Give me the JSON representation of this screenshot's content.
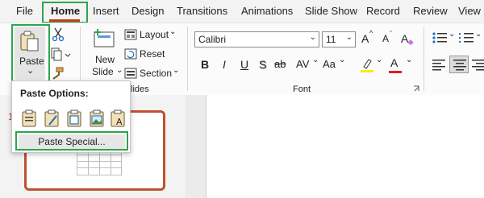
{
  "menu": {
    "tabs": [
      "File",
      "Home",
      "Insert",
      "Design",
      "Transitions",
      "Animations",
      "Slide Show",
      "Record",
      "Review",
      "View"
    ],
    "active": "Home"
  },
  "clipboard": {
    "paste_label": "Paste",
    "paste_arrow": "⌄"
  },
  "slides": {
    "new_slide_line1": "New",
    "new_slide_line2": "Slide",
    "layout_label": "Layout",
    "reset_label": "Reset",
    "section_label": "Section",
    "group_label": "lides"
  },
  "font": {
    "family": "Calibri",
    "size": "11",
    "grow_label": "A",
    "shrink_label": "A",
    "clear_label": "A",
    "bold": "B",
    "italic": "I",
    "underline": "U",
    "shadow": "S",
    "strike": "ab",
    "spacing": "AV",
    "case": "Aa",
    "highlight": "ab",
    "color": "A",
    "group_label": "Font"
  },
  "paste_menu": {
    "title": "Paste Options:",
    "special_label": "Paste Special..."
  },
  "thumbnail": {
    "number": "1"
  },
  "colors": {
    "accent_red": "#c43e1c",
    "highlight_green": "#2ea44f",
    "thumb_border": "#c0502f"
  }
}
